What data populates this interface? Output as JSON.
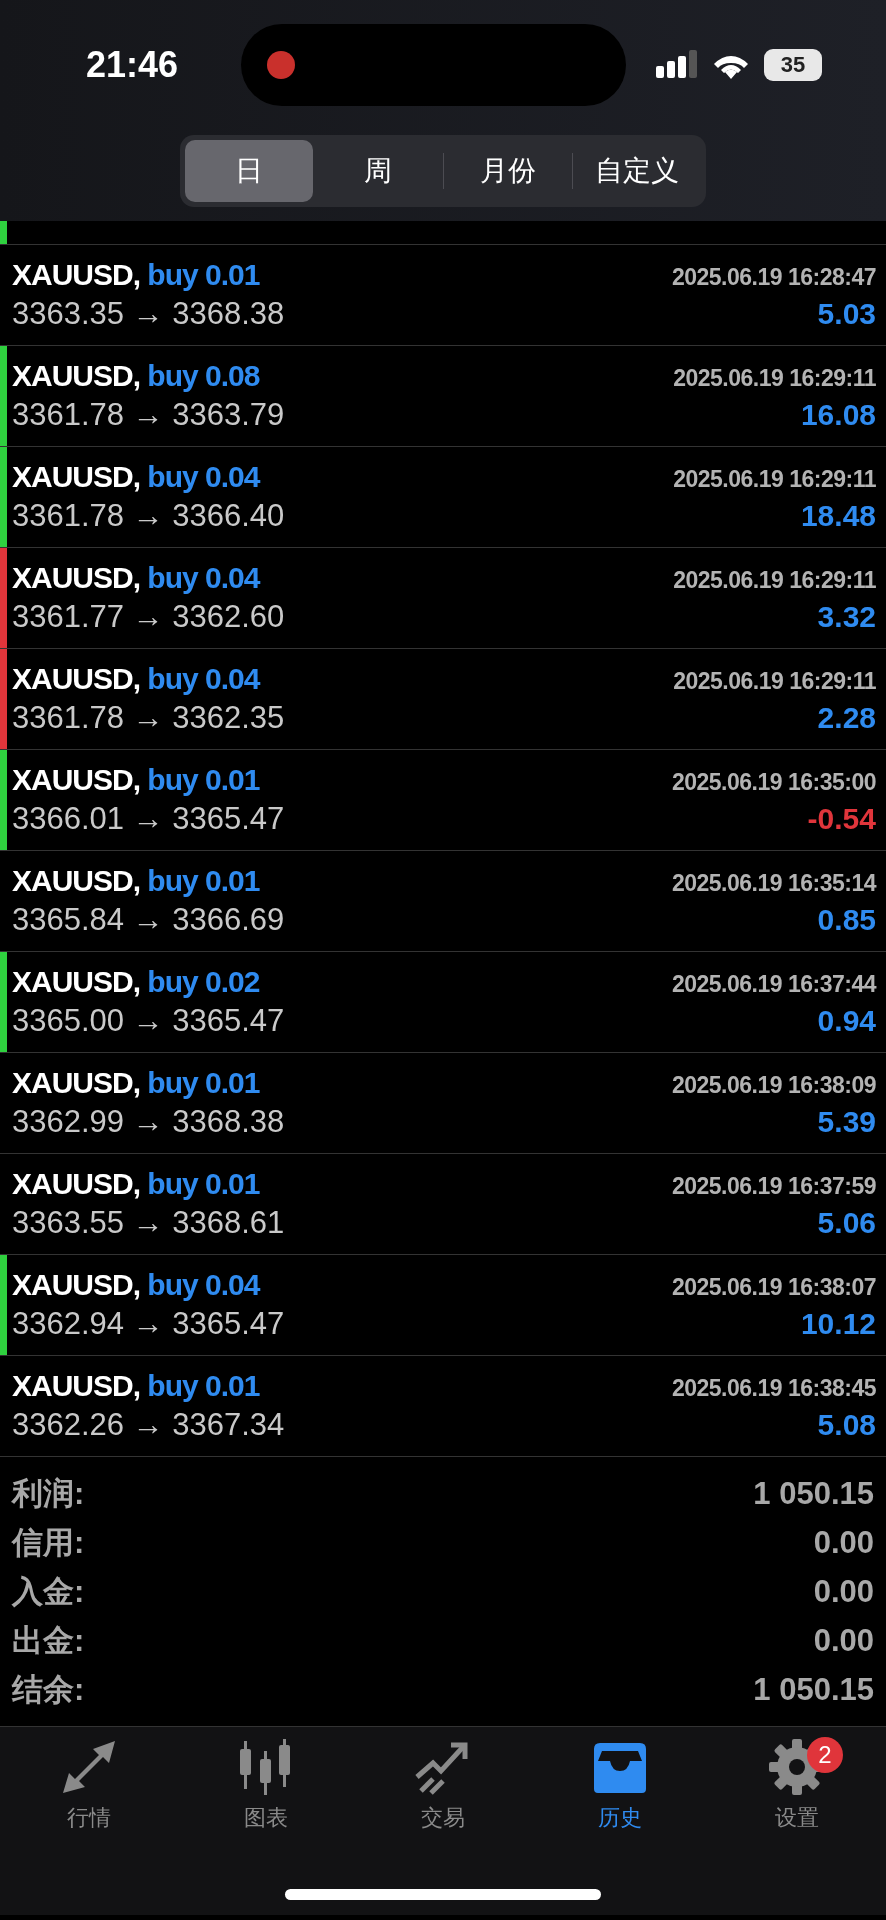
{
  "status_bar": {
    "time": "21:46",
    "battery": "35",
    "recording": true
  },
  "periods": [
    {
      "label": "日",
      "selected": true
    },
    {
      "label": "周",
      "selected": false
    },
    {
      "label": "月份",
      "selected": false
    },
    {
      "label": "自定义",
      "selected": false
    }
  ],
  "partial_row": {
    "color": "#2fd13f"
  },
  "deals": [
    {
      "symbol": "XAUUSD,",
      "side": "buy 0.01",
      "time": "2025.06.19 16:28:47",
      "prices": "3363.35 → 3368.38",
      "profit": "5.03",
      "negative": false
    },
    {
      "symbol": "XAUUSD,",
      "side": "buy 0.08",
      "time": "2025.06.19 16:29:11",
      "prices": "3361.78 → 3363.79",
      "profit": "16.08",
      "negative": false,
      "color": "#2fd13f"
    },
    {
      "symbol": "XAUUSD,",
      "side": "buy 0.04",
      "time": "2025.06.19 16:29:11",
      "prices": "3361.78 → 3366.40",
      "profit": "18.48",
      "negative": false,
      "color": "#2fd13f"
    },
    {
      "symbol": "XAUUSD,",
      "side": "buy 0.04",
      "time": "2025.06.19 16:29:11",
      "prices": "3361.77 → 3362.60",
      "profit": "3.32",
      "negative": false,
      "color": "#e0353b"
    },
    {
      "symbol": "XAUUSD,",
      "side": "buy 0.04",
      "time": "2025.06.19 16:29:11",
      "prices": "3361.78 → 3362.35",
      "profit": "2.28",
      "negative": false,
      "color": "#e0353b"
    },
    {
      "symbol": "XAUUSD,",
      "side": "buy 0.01",
      "time": "2025.06.19 16:35:00",
      "prices": "3366.01 → 3365.47",
      "profit": "-0.54",
      "negative": true,
      "color": "#2fd13f"
    },
    {
      "symbol": "XAUUSD,",
      "side": "buy 0.01",
      "time": "2025.06.19 16:35:14",
      "prices": "3365.84 → 3366.69",
      "profit": "0.85",
      "negative": false
    },
    {
      "symbol": "XAUUSD,",
      "side": "buy 0.02",
      "time": "2025.06.19 16:37:44",
      "prices": "3365.00 → 3365.47",
      "profit": "0.94",
      "negative": false,
      "color": "#2fd13f"
    },
    {
      "symbol": "XAUUSD,",
      "side": "buy 0.01",
      "time": "2025.06.19 16:38:09",
      "prices": "3362.99 → 3368.38",
      "profit": "5.39",
      "negative": false
    },
    {
      "symbol": "XAUUSD,",
      "side": "buy 0.01",
      "time": "2025.06.19 16:37:59",
      "prices": "3363.55 → 3368.61",
      "profit": "5.06",
      "negative": false
    },
    {
      "symbol": "XAUUSD,",
      "side": "buy 0.04",
      "time": "2025.06.19 16:38:07",
      "prices": "3362.94 → 3365.47",
      "profit": "10.12",
      "negative": false,
      "color": "#2fd13f"
    },
    {
      "symbol": "XAUUSD,",
      "side": "buy 0.01",
      "time": "2025.06.19 16:38:45",
      "prices": "3362.26 → 3367.34",
      "profit": "5.08",
      "negative": false
    }
  ],
  "summary": [
    {
      "label": "利润:",
      "value": "1 050.15"
    },
    {
      "label": "信用:",
      "value": "0.00"
    },
    {
      "label": "入金:",
      "value": "0.00"
    },
    {
      "label": "出金:",
      "value": "0.00"
    },
    {
      "label": "结余:",
      "value": "1 050.15"
    }
  ],
  "tabs": [
    {
      "kind": "quotes",
      "label": "行情",
      "selected": false
    },
    {
      "kind": "chart",
      "label": "图表",
      "selected": false
    },
    {
      "kind": "trade",
      "label": "交易",
      "selected": false
    },
    {
      "kind": "history",
      "label": "历史",
      "selected": true
    },
    {
      "kind": "settings",
      "label": "设置",
      "selected": false,
      "badge": "2"
    }
  ]
}
